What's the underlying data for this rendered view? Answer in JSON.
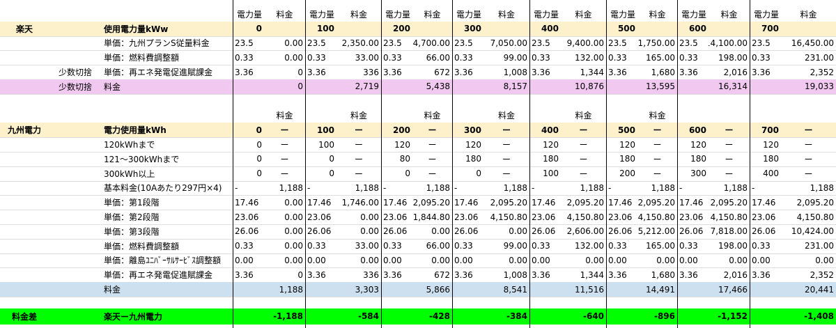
{
  "colors": {
    "rakuten_header": "#fdf1cc",
    "rakuten_total": "#f0c8f0",
    "kyuden_header": "#fdf1cc",
    "kyuden_total": "#cce0f0",
    "diff_row": "#00ff00"
  },
  "rakuten": {
    "top_headers": [
      "電力量",
      "料金",
      "電力量",
      "料金",
      "電力量",
      "料金",
      "電力量",
      "料金",
      "電力量",
      "料金",
      "電力量",
      "料金",
      "電力量",
      "料金",
      "電力量",
      "料金"
    ],
    "rows": [
      {
        "a": "楽天",
        "b": "",
        "c": "使用電力量kWw",
        "v": [
          "0",
          "",
          "100",
          "",
          "200",
          "",
          "300",
          "",
          "400",
          "",
          "500",
          "",
          "600",
          "",
          "700",
          ""
        ]
      },
      {
        "a": "",
        "b": "",
        "c": "単価：九州プランS従量料金",
        "v": [
          "23.5",
          "0.00",
          "23.5",
          "2,350.00",
          "23.5",
          "4,700.00",
          "23.5",
          "7,050.00",
          "23.5",
          "9,400.00",
          "23.5",
          "11,750.00",
          "23.5",
          "14,100.00",
          "23.5",
          "16,450.00"
        ]
      },
      {
        "a": "",
        "b": "",
        "c": "単価：燃料費調整額",
        "v": [
          "0.33",
          "0.00",
          "0.33",
          "33.00",
          "0.33",
          "66.00",
          "0.33",
          "99.00",
          "0.33",
          "132.00",
          "0.33",
          "165.00",
          "0.33",
          "198.00",
          "0.33",
          "231.00"
        ]
      },
      {
        "a": "",
        "b": "少数切捨",
        "c": "単価：再エネ発電促進賦課金",
        "v": [
          "3.36",
          "0",
          "3.36",
          "336",
          "3.36",
          "672",
          "3.36",
          "1,008",
          "3.36",
          "1,344",
          "3.36",
          "1,680",
          "3.36",
          "2,016",
          "3.36",
          "2,352"
        ]
      },
      {
        "a": "",
        "b": "少数切捨",
        "c": "料金",
        "v": [
          "",
          "0",
          "",
          "2,719",
          "",
          "5,438",
          "",
          "8,157",
          "",
          "10,876",
          "",
          "13,595",
          "",
          "16,314",
          "",
          "19,033"
        ]
      }
    ]
  },
  "kyuden": {
    "headers": [
      "料金",
      "料金",
      "料金",
      "料金",
      "料金",
      "料金"
    ],
    "rows": [
      {
        "a": "九州電力",
        "c": "電力使用量kWh",
        "v": [
          "0",
          "ー",
          "100",
          "ー",
          "200",
          "ー",
          "300",
          "ー",
          "400",
          "ー",
          "500",
          "ー",
          "600",
          "ー",
          "700",
          "ー"
        ]
      },
      {
        "a": "",
        "c": "120kWhまで",
        "v": [
          "0",
          "ー",
          "100",
          "ー",
          "120",
          "ー",
          "120",
          "ー",
          "120",
          "ー",
          "120",
          "ー",
          "120",
          "ー",
          "120",
          "ー"
        ]
      },
      {
        "a": "",
        "c": "121〜300kWhまで",
        "v": [
          "0",
          "ー",
          "0",
          "ー",
          "80",
          "ー",
          "180",
          "ー",
          "180",
          "ー",
          "180",
          "ー",
          "180",
          "ー",
          "180",
          "ー"
        ]
      },
      {
        "a": "",
        "c": "300kWh以上",
        "v": [
          "0",
          "ー",
          "0",
          "ー",
          "0",
          "ー",
          "0",
          "ー",
          "100",
          "ー",
          "200",
          "ー",
          "300",
          "ー",
          "400",
          "ー"
        ]
      },
      {
        "a": "",
        "c": "基本料金(10Aあたり297円×4)",
        "v": [
          "-",
          "1,188",
          "-",
          "1,188",
          "-",
          "1,188",
          "-",
          "1,188",
          "-",
          "1,188",
          "-",
          "1,188",
          "-",
          "1,188",
          "-",
          "1,188"
        ]
      },
      {
        "a": "",
        "c": "単価：第1段階",
        "v": [
          "17.46",
          "0.00",
          "17.46",
          "1,746.00",
          "17.46",
          "2,095.20",
          "17.46",
          "2,095.20",
          "17.46",
          "2,095.20",
          "17.46",
          "2,095.20",
          "17.46",
          "2,095.20",
          "17.46",
          "2,095.20"
        ]
      },
      {
        "a": "",
        "c": "単価：第2段階",
        "v": [
          "23.06",
          "0.00",
          "23.06",
          "0.00",
          "23.06",
          "1,844.80",
          "23.06",
          "4,150.80",
          "23.06",
          "4,150.80",
          "23.06",
          "4,150.80",
          "23.06",
          "4,150.80",
          "23.06",
          "4,150.80"
        ]
      },
      {
        "a": "",
        "c": "単価：第3段階",
        "v": [
          "26.06",
          "0.00",
          "26.06",
          "0.00",
          "26.06",
          "0.00",
          "26.06",
          "0.00",
          "26.06",
          "2,606.00",
          "26.06",
          "5,212.00",
          "26.06",
          "7,818.00",
          "26.06",
          "10,424.00"
        ]
      },
      {
        "a": "",
        "c": "単価：燃料費調整額",
        "v": [
          "0.33",
          "0.00",
          "0.33",
          "33.00",
          "0.33",
          "66.00",
          "0.33",
          "99.00",
          "0.33",
          "132.00",
          "0.33",
          "165.00",
          "0.33",
          "198.00",
          "0.33",
          "231.00"
        ]
      },
      {
        "a": "",
        "c": "単価：離島ﾕﾆﾊﾞｰｻﾙｻｰﾋﾞｽ調整額",
        "v": [
          "0.00",
          "0.00",
          "0.00",
          "0.00",
          "0.00",
          "0.00",
          "0.00",
          "0.00",
          "0.00",
          "0.00",
          "0.00",
          "0.00",
          "0.00",
          "0.00",
          "0.00",
          "0.00"
        ]
      },
      {
        "a": "",
        "c": "単価：再エネ発電促進賦課金",
        "v": [
          "3.36",
          "0",
          "3.36",
          "336",
          "3.36",
          "672",
          "3.36",
          "1,008",
          "3.36",
          "1,344",
          "3.36",
          "1,680",
          "3.36",
          "2,016",
          "3.36",
          "2,352"
        ]
      },
      {
        "a": "",
        "c": "料金",
        "v": [
          "",
          "1,188",
          "",
          "3,303",
          "",
          "5,866",
          "",
          "8,541",
          "",
          "11,516",
          "",
          "14,491",
          "",
          "17,466",
          "",
          "20,441"
        ]
      }
    ]
  },
  "diff": {
    "a": "料金差",
    "c": "楽天ー九州電力",
    "values": [
      "-1,188",
      "-584",
      "-428",
      "-384",
      "-640",
      "-896",
      "-1,152",
      "-1,408"
    ]
  }
}
